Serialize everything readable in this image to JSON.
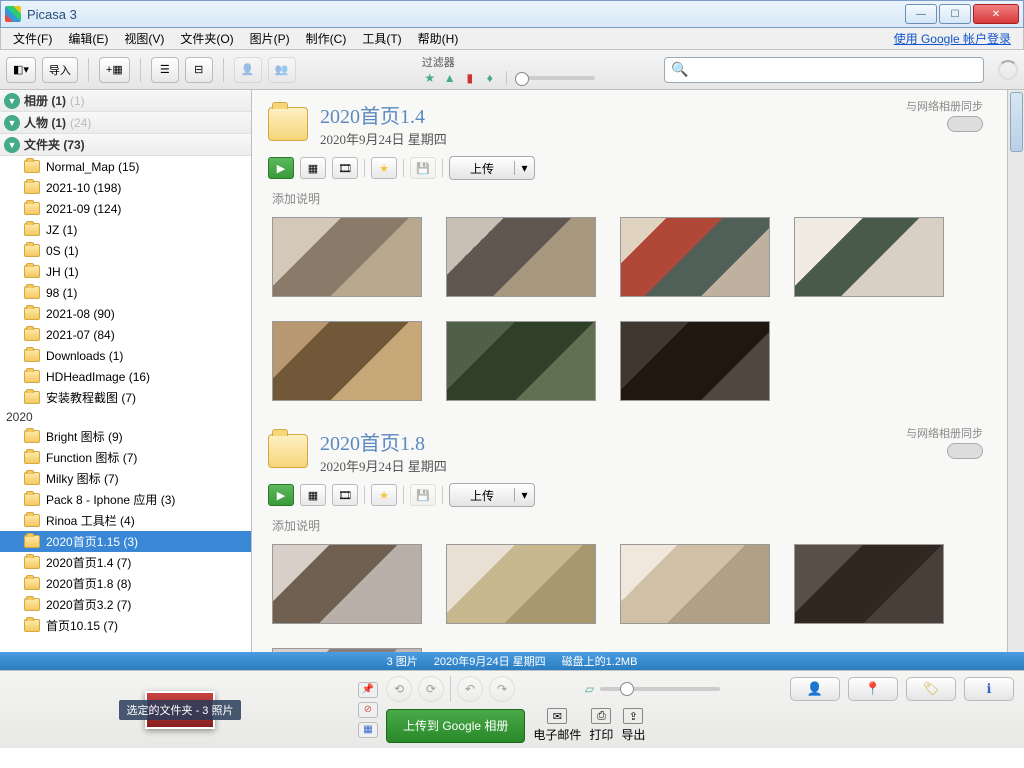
{
  "window": {
    "title": "Picasa 3"
  },
  "menu": {
    "items": [
      "文件(F)",
      "编辑(E)",
      "视图(V)",
      "文件夹(O)",
      "图片(P)",
      "制作(C)",
      "工具(T)",
      "帮助(H)"
    ],
    "login": "使用 Google 帐户登录"
  },
  "toolbar": {
    "import": "导入",
    "filter_label": "过滤器"
  },
  "sidebar": {
    "categories": [
      {
        "name": "相册 (1)",
        "dim": "(1)"
      },
      {
        "name": "人物 (1)",
        "dim": "(24)"
      },
      {
        "name": "文件夹 (73)",
        "dim": ""
      }
    ],
    "folders": [
      {
        "name": "Normal_Map (15)"
      },
      {
        "name": "2021-10 (198)"
      },
      {
        "name": "2021-09 (124)"
      },
      {
        "name": "JZ (1)"
      },
      {
        "name": "0S (1)"
      },
      {
        "name": "JH (1)"
      },
      {
        "name": "98 (1)"
      },
      {
        "name": "2021-08 (90)"
      },
      {
        "name": "2021-07 (84)"
      },
      {
        "name": "Downloads (1)"
      },
      {
        "name": "HDHeadImage (16)"
      },
      {
        "name": "安装教程截图 (7)"
      }
    ],
    "year": "2020",
    "folders2": [
      {
        "name": "Bright 图标 (9)"
      },
      {
        "name": "Function 图标 (7)"
      },
      {
        "name": "Milky 图标 (7)"
      },
      {
        "name": "Pack 8 - Iphone 应用 (3)"
      },
      {
        "name": "Rinoa 工具栏 (4)"
      },
      {
        "name": "2020首页1.15 (3)",
        "sel": true
      },
      {
        "name": "2020首页1.4 (7)"
      },
      {
        "name": "2020首页1.8 (8)"
      },
      {
        "name": "2020首页3.2 (7)"
      },
      {
        "name": "首页10.15 (7)"
      }
    ]
  },
  "albums": [
    {
      "title": "2020首页1.4",
      "date": "2020年9月24日 星期四",
      "sync": "与网络相册同步",
      "upload": "上传",
      "caption": "添加说明",
      "thumbs": [
        "r1",
        "r2",
        "r3",
        "r4",
        "r5",
        "r6",
        "r7"
      ]
    },
    {
      "title": "2020首页1.8",
      "date": "2020年9月24日 星期四",
      "sync": "与网络相册同步",
      "upload": "上传",
      "caption": "添加说明",
      "thumbs": [
        "r8",
        "r9",
        "r10",
        "r11",
        "r12"
      ]
    }
  ],
  "status": {
    "count": "3 图片",
    "date": "2020年9月24日 星期四",
    "disk": "磁盘上的1.2MB"
  },
  "tray": {
    "label": "选定的文件夹 - 3 照片"
  },
  "bottom": {
    "upload": "上传到 Google 相册",
    "email": "电子邮件",
    "print": "打印",
    "export": "导出"
  }
}
